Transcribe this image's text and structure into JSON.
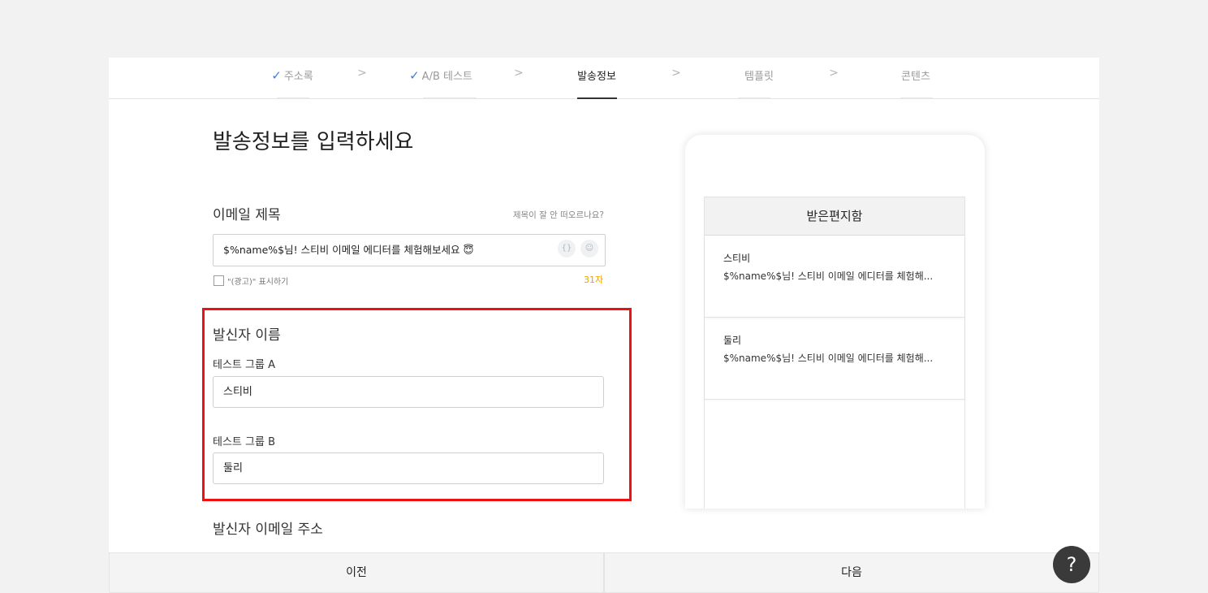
{
  "stepper": {
    "steps": [
      {
        "label": "주소록",
        "done": true
      },
      {
        "label": "A/B 테스트",
        "done": true
      },
      {
        "label": "발송정보",
        "active": true
      },
      {
        "label": "템플릿"
      },
      {
        "label": "콘텐츠"
      }
    ],
    "separator": ">",
    "check_glyph": "✓"
  },
  "form": {
    "title": "발송정보를 입력하세요",
    "subject_label": "이메일 제목",
    "subject_hint": "제목이 잘 안 떠오르나요?",
    "subject_value": "$%name%$님! 스티비 이메일 에디터를 체험해보세요 😇",
    "subject_tools": {
      "variable_glyph": "{}",
      "emoji_glyph": "☺"
    },
    "ad_checkbox_label": "\"(광고)\" 표시하기",
    "char_count": "31자",
    "sender_name_label": "발신자 이름",
    "group_a_label": "테스트 그룹 A",
    "group_a_value": "스티비",
    "group_b_label": "테스트 그룹 B",
    "group_b_value": "둘리",
    "sender_email_label": "발신자 이메일 주소"
  },
  "preview": {
    "inbox_title": "받은편지함",
    "mails": [
      {
        "sender": "스티비",
        "subject": "$%name%$님! 스티비 이메일 에디터를 체험해..."
      },
      {
        "sender": "둘리",
        "subject": "$%name%$님! 스티비 이메일 에디터를 체험해..."
      }
    ]
  },
  "footer": {
    "prev_label": "이전",
    "next_label": "다음",
    "help_glyph": "?"
  },
  "colors": {
    "accent_check": "#3b7ddd",
    "char_count": "#f2a100",
    "highlight_box": "#ee1111",
    "help_button": "#3a3a3a"
  }
}
